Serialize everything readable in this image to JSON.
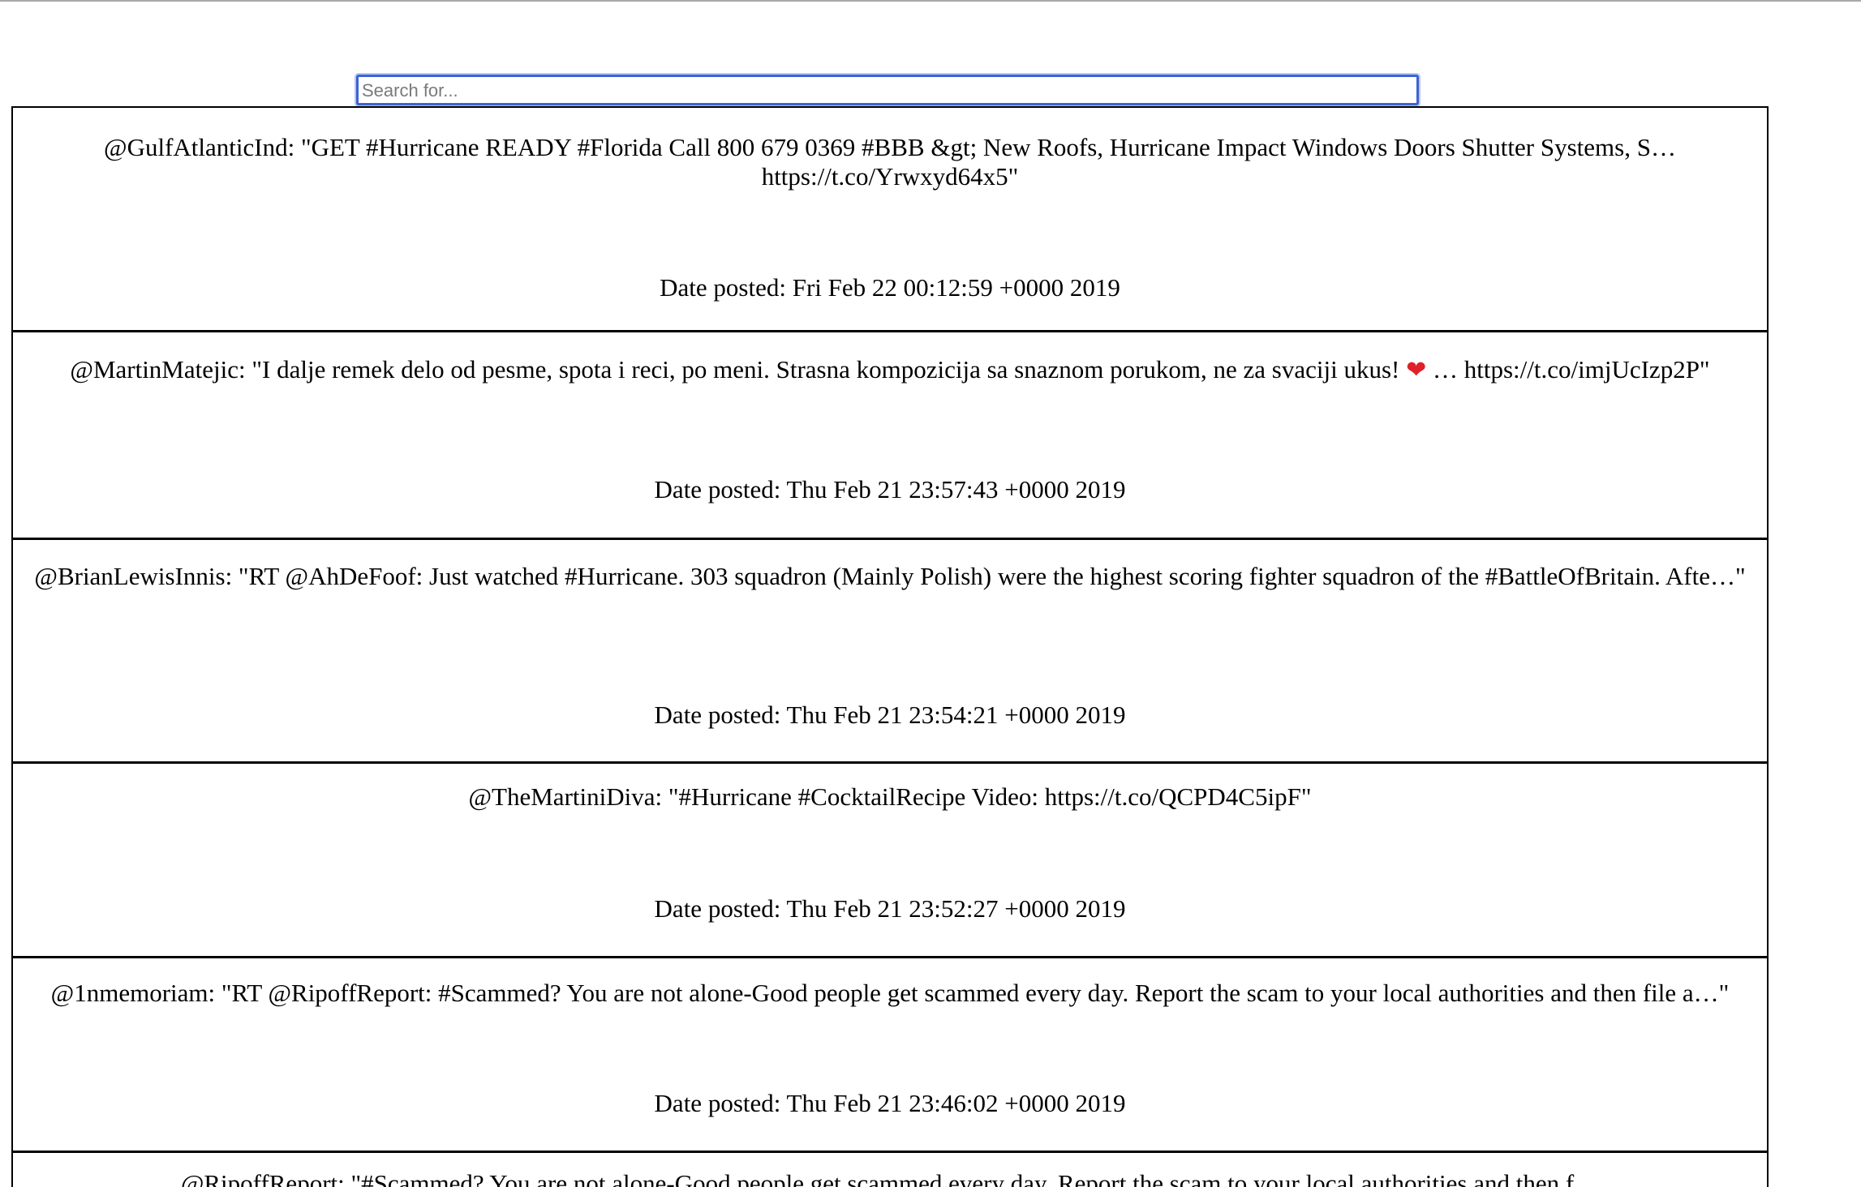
{
  "search": {
    "placeholder": "Search for...",
    "value": ""
  },
  "tweets": [
    {
      "text": "@GulfAtlanticInd: \"GET #Hurricane READY #Florida Call 800 679 0369 #BBB &gt; New Roofs, Hurricane Impact Windows Doors Shutter Systems, S… https://t.co/Yrwxyd64x5\"",
      "date": "Date posted: Fri Feb 22 00:12:59 +0000 2019"
    },
    {
      "text_before": "@MartinMatejic: \"I dalje remek delo od pesme, spota i reci, po meni. Strasna kompozicija sa snaznom porukom, ne za svaciji ukus! ",
      "emoji": "❤",
      "text_after": " … https://t.co/imjUcIzp2P\"",
      "date": "Date posted: Thu Feb 21 23:57:43 +0000 2019"
    },
    {
      "text": "@BrianLewisInnis: \"RT @AhDeFoof: Just watched #Hurricane. 303 squadron (Mainly Polish) were the highest scoring fighter squadron of the #BattleOfBritain. Afte…\"",
      "date": "Date posted: Thu Feb 21 23:54:21 +0000 2019"
    },
    {
      "text": "@TheMartiniDiva: \"#Hurricane #CocktailRecipe Video: https://t.co/QCPD4C5ipF\"",
      "date": "Date posted: Thu Feb 21 23:52:27 +0000 2019"
    },
    {
      "text": "@1nmemoriam: \"RT @RipoffReport: #Scammed? You are not alone-Good people get scammed every day. Report the scam to your local authorities and then file a…\"",
      "date": "Date posted: Thu Feb 21 23:46:02 +0000 2019"
    },
    {
      "text": "@RipoffReport: \"#Scammed? You are not alone-Good people get scammed every day. Report the scam to your local authorities and then f…"
    }
  ]
}
